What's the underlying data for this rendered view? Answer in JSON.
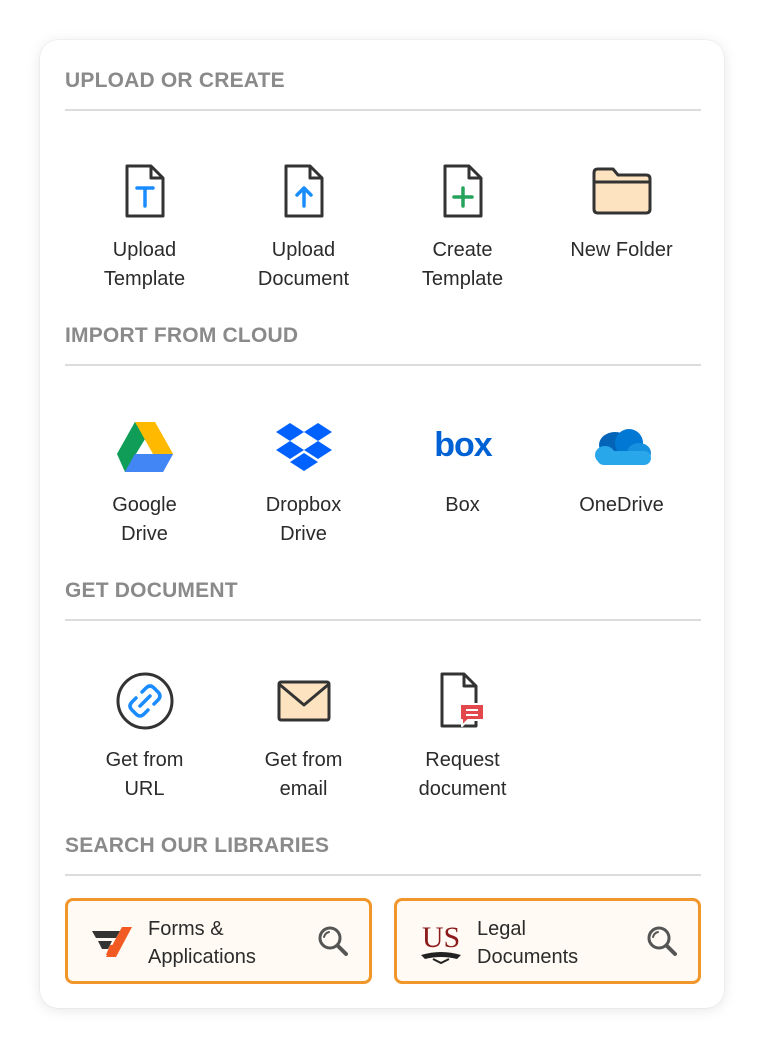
{
  "colors": {
    "section_title": "#8a8a8a",
    "divider": "#dcdcdc",
    "accent_orange": "#f0962a",
    "icon_blue": "#1a8cff",
    "icon_green": "#25a35a",
    "folder_fill": "#fde3c0"
  },
  "sections": {
    "upload": {
      "title": "UPLOAD OR CREATE",
      "items": [
        {
          "line1": "Upload",
          "line2": "Template",
          "icon": "upload-template-icon"
        },
        {
          "line1": "Upload",
          "line2": "Document",
          "icon": "upload-document-icon"
        },
        {
          "line1": "Create",
          "line2": "Template",
          "icon": "create-template-icon"
        },
        {
          "line1": "New Folder",
          "line2": "",
          "icon": "folder-icon"
        }
      ]
    },
    "cloud": {
      "title": "IMPORT FROM CLOUD",
      "items": [
        {
          "line1": "Google",
          "line2": "Drive",
          "icon": "google-drive-icon"
        },
        {
          "line1": "Dropbox",
          "line2": "Drive",
          "icon": "dropbox-icon"
        },
        {
          "line1": "Box",
          "line2": "",
          "icon": "box-icon"
        },
        {
          "line1": "OneDrive",
          "line2": "",
          "icon": "onedrive-icon"
        }
      ]
    },
    "get": {
      "title": "GET DOCUMENT",
      "items": [
        {
          "line1": "Get from",
          "line2": "URL",
          "icon": "link-icon"
        },
        {
          "line1": "Get from",
          "line2": "email",
          "icon": "envelope-icon"
        },
        {
          "line1": "Request",
          "line2": "document",
          "icon": "request-document-icon"
        }
      ]
    },
    "libraries": {
      "title": "SEARCH OUR LIBRARIES",
      "buttons": [
        {
          "line1": "Forms &",
          "line2": "Applications",
          "icon": "forms-logo-icon"
        },
        {
          "line1": "Legal",
          "line2": "Documents",
          "icon": "us-legal-logo-icon"
        }
      ]
    }
  },
  "box_logo_text": "box",
  "us_logo_text": "US"
}
